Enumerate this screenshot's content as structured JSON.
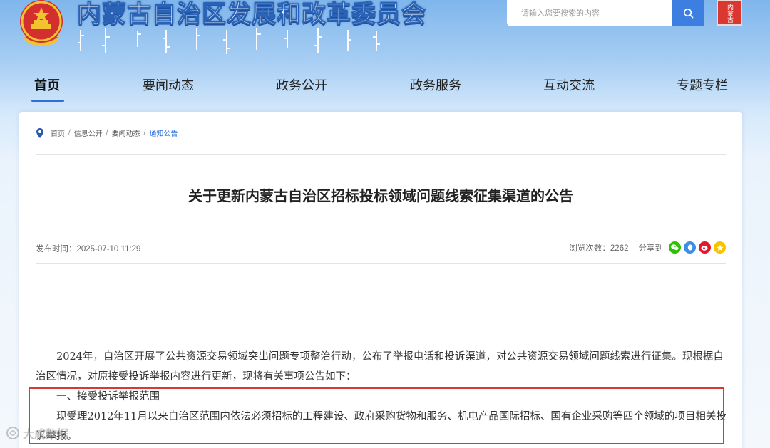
{
  "header": {
    "site_title": "内蒙古自治区发展和改革委员会",
    "search_placeholder": "请输入您要搜索的内容",
    "seal_text": "内蒙古"
  },
  "nav": {
    "items": [
      {
        "label": "首页",
        "active": true
      },
      {
        "label": "要闻动态",
        "active": false
      },
      {
        "label": "政务公开",
        "active": false
      },
      {
        "label": "政务服务",
        "active": false
      },
      {
        "label": "互动交流",
        "active": false
      },
      {
        "label": "专题专栏",
        "active": false
      }
    ]
  },
  "breadcrumb": {
    "items": [
      "首页",
      "信息公开",
      "要闻动态",
      "通知公告"
    ],
    "separator": "/"
  },
  "article": {
    "title": "关于更新内蒙古自治区招标投标领域问题线索征集渠道的公告",
    "publish_label": "发布时间：",
    "publish_time": "2025-07-10 11:29",
    "views_label": "浏览次数：",
    "views": "2262",
    "share_label": "分享到",
    "share_icons": [
      {
        "name": "wechat-share-icon",
        "color": "#2dc100"
      },
      {
        "name": "qq-share-icon",
        "color": "#3a8ee6"
      },
      {
        "name": "weibo-share-icon",
        "color": "#e6162d"
      },
      {
        "name": "qzone-share-icon",
        "color": "#f5c400"
      }
    ],
    "paragraphs": [
      "2024年，自治区开展了公共资源交易领域突出问题专项整治行动，公布了举报电话和投诉渠道，对公共资源交易领域问题线索进行征集。现根据自治区情况，对原接受投诉举报内容进行更新，现将有关事项公告如下：",
      "一、接受投诉举报范围",
      "现受理2012年11月以来自治区范围内依法必须招标的工程建设、政府采购货物和服务、机电产品国际招标、国有企业采购等四个领域的项目相关投诉举报。"
    ]
  },
  "watermark": "大成数据",
  "colors": {
    "accent": "#2f6fd8",
    "highlight_border": "#d83a32",
    "search_button": "#3d7fe0"
  }
}
